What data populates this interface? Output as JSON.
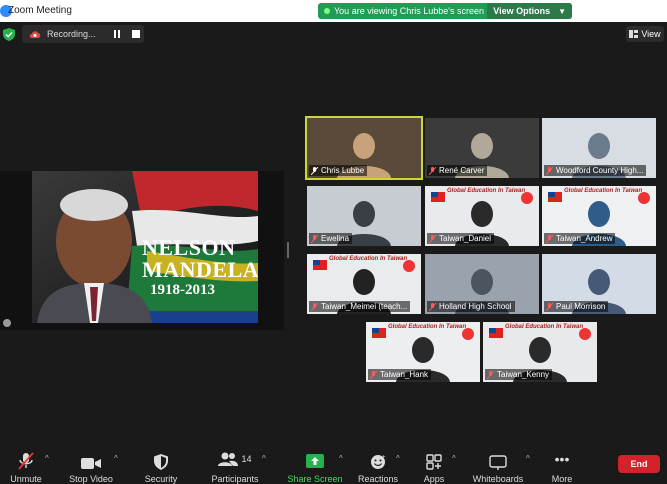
{
  "window": {
    "title": "Zoom Meeting"
  },
  "share_banner": {
    "text": "You are viewing Chris Lubbe's screen",
    "options_label": "View Options"
  },
  "recording": {
    "label": "Recording..."
  },
  "view_button": {
    "label": "View"
  },
  "slide": {
    "name_line1": "NELSON",
    "name_line2": "MANDELA",
    "years": "1918-2013"
  },
  "participants": [
    {
      "name": "Chris Lubbe",
      "active": true
    },
    {
      "name": "René Carver"
    },
    {
      "name": "Woodford County High..."
    },
    {
      "name": "Ewelina"
    },
    {
      "name": "Taiwan_Daniel"
    },
    {
      "name": "Taiwan_Andrew"
    },
    {
      "name": "Taiwan_Meimei (teach..."
    },
    {
      "name": "Holland High School"
    },
    {
      "name": "Paul Morrison"
    },
    {
      "name": "Taiwan_Hank"
    },
    {
      "name": "Taiwan_Kenny"
    }
  ],
  "tile_banner": "Global Education In Taiwan",
  "toolbar": {
    "unmute": "Unmute",
    "stop_video": "Stop Video",
    "security": "Security",
    "participants": "Participants",
    "participants_count": "14",
    "share_screen": "Share Screen",
    "reactions": "Reactions",
    "apps": "Apps",
    "whiteboards": "Whiteboards",
    "more": "More",
    "end": "End"
  },
  "colors": {
    "active_outline": "#c9d93a",
    "share_green": "#1f9d55",
    "end_red": "#d3222a"
  }
}
